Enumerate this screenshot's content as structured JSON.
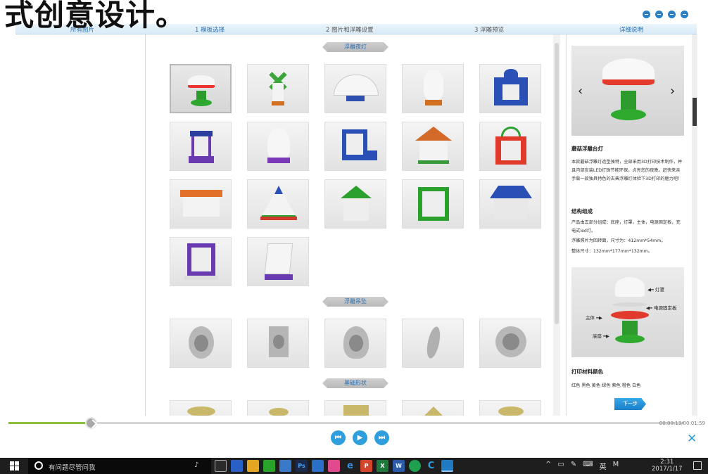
{
  "overlay": {
    "subtitle": "式创意设计。"
  },
  "steps": {
    "all_images": "所有图片",
    "step1": "1 模板选择",
    "step2": "2 图片和浮雕设置",
    "step3": "3 浮雕预览",
    "details": "详细说明"
  },
  "sections": [
    {
      "label": "浮雕夜灯"
    },
    {
      "label": "浮雕吊坠"
    },
    {
      "label": "基础形状"
    }
  ],
  "right_panel": {
    "prev_icon": "‹",
    "next_icon": "›",
    "title": "蘑菇浮雕台灯",
    "description": "本款蘑菇浮雕灯造型独特，全部采用3D打印技术制作，并且内部安装LED灯珠节能环保，点亮您的夜晚。赶快来亲手做一款独具特色的古典浮雕灯体验下3D打印的魅力吧！",
    "structure_title": "结构组成",
    "structure_text": "产品由五部分组成：底座，灯罩，主体，电源固定板，充电式led灯。",
    "size_line1": "浮雕照片为回转面，尺寸为：412mm*54mm。",
    "size_line2": "整体尺寸：132mm*177mm*132mm。",
    "diagram_labels": {
      "lampshade": "灯罩",
      "power_board": "电源固定板",
      "body": "主体",
      "base": "底座"
    },
    "material_title": "打印材料颜色",
    "material_colors": "红色 黑色 黄色 绿色 紫色 橙色 白色",
    "next_button": "下一步"
  },
  "player": {
    "progress": 0.12,
    "time": "00:00:13/00:01:59",
    "prev_label": "◀",
    "play_label": "▶",
    "next_label": "▶"
  },
  "taskbar": {
    "search_placeholder": "有问题尽管问我",
    "ime_lang": "英",
    "ime_mode": "M",
    "time": "2:31",
    "date": "2017/1/17"
  },
  "colors": {
    "accent": "#2e9edd",
    "progress": "#8fbf40",
    "taskbar": "#1e1e1e"
  }
}
